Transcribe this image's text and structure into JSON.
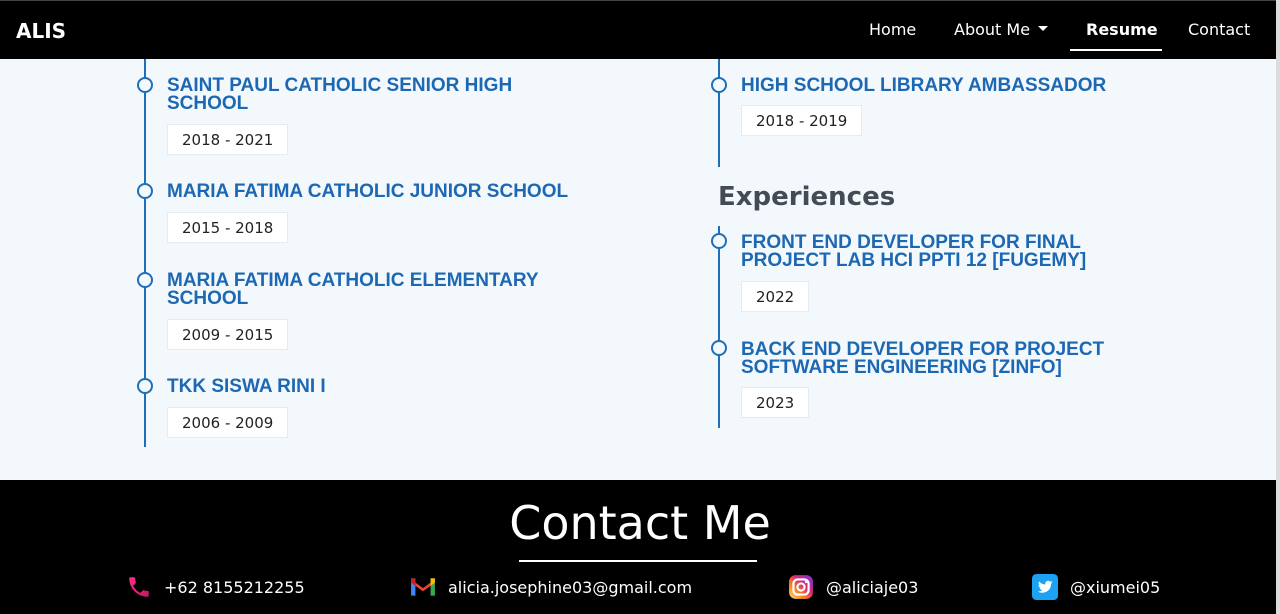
{
  "navbar": {
    "brand": "ALIS",
    "links": {
      "home": "Home",
      "about": "About Me",
      "resume": "Resume",
      "contact": "Contact"
    }
  },
  "education": [
    {
      "title_line1": "SAINT PAUL CATHOLIC SENIOR HIGH",
      "title_line2": "SCHOOL",
      "years": "2018 - 2021"
    },
    {
      "title_line1": "MARIA FATIMA CATHOLIC JUNIOR SCHOOL",
      "title_line2": "",
      "years": "2015 - 2018"
    },
    {
      "title_line1": "MARIA FATIMA CATHOLIC ELEMENTARY",
      "title_line2": "SCHOOL",
      "years": "2009 - 2015"
    },
    {
      "title_line1": "TKK SISWA RINI I",
      "title_line2": "",
      "years": "2006 - 2009"
    }
  ],
  "organizations": [
    {
      "title_line1": "HIGH SCHOOL LIBRARY AMBASSADOR",
      "title_line2": "",
      "years": "2018 - 2019"
    }
  ],
  "experiences": {
    "heading": "Experiences",
    "items": [
      {
        "title_line1": "FRONT END DEVELOPER FOR FINAL",
        "title_line2": "PROJECT LAB HCI PPTI 12 [FUGEMY]",
        "years": "2022"
      },
      {
        "title_line1": "BACK END DEVELOPER FOR PROJECT",
        "title_line2": "SOFTWARE ENGINEERING [ZINFO]",
        "years": "2023"
      }
    ]
  },
  "footer": {
    "title": "Contact Me",
    "contacts": {
      "phone": "+62 8155212255",
      "email": "alicia.josephine03@gmail.com",
      "instagram": "@aliciaje03",
      "twitter": "@xiumei05"
    }
  },
  "colors": {
    "accent": "#1e6fb7",
    "title": "#1d68b3",
    "background": "#f3f8fd",
    "nav": "#000000"
  }
}
